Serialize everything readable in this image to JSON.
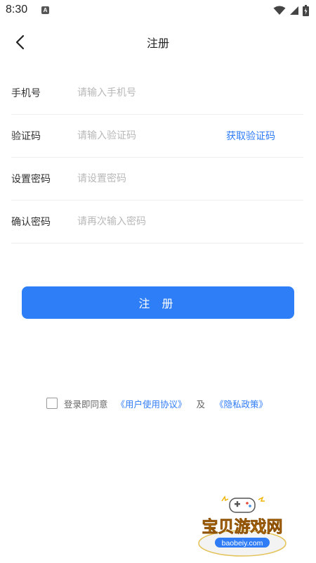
{
  "status": {
    "time": "8:30",
    "notif_glyph": "A"
  },
  "header": {
    "title": "注册"
  },
  "form": {
    "rows": [
      {
        "label": "手机号",
        "placeholder": "请输入手机号"
      },
      {
        "label": "验证码",
        "placeholder": "请输入验证码",
        "action": "获取验证码"
      },
      {
        "label": "设置密码",
        "placeholder": "请设置密码"
      },
      {
        "label": "确认密码",
        "placeholder": "请再次输入密码"
      }
    ]
  },
  "submit": {
    "label": "注 册"
  },
  "agreement": {
    "prefix": "登录即同意",
    "user_agreement": "《用户使用协议》",
    "and": "及",
    "privacy_policy": "《隐私政策》"
  },
  "watermark": {
    "title": "宝贝游戏网",
    "domain": "baobeiy.com"
  },
  "colors": {
    "accent": "#2e7ff7",
    "link": "#2f7cf6",
    "placeholder": "#b8b8b8"
  },
  "icons": [
    "back-arrow-icon",
    "wifi-icon",
    "signal-icon",
    "battery-icon",
    "checkbox-icon",
    "gamepad-icon"
  ]
}
